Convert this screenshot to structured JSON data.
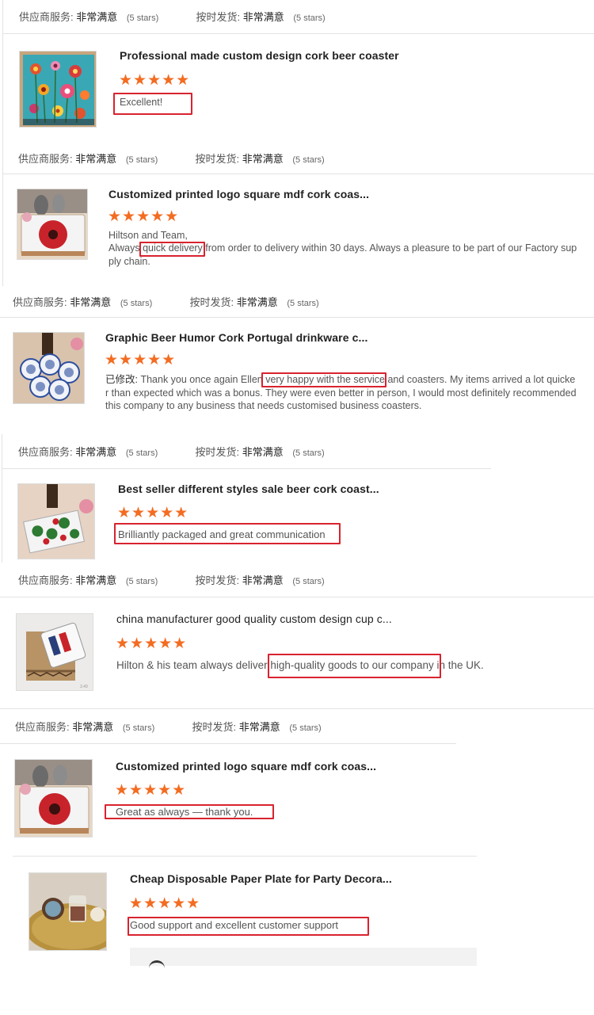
{
  "ratings_row": {
    "supplier_label": "供应商服务:",
    "supplier_value": "非常满意",
    "supplier_stars": "(5 stars)",
    "ontime_label": "按时发货:",
    "ontime_value": "非常满意",
    "ontime_stars": "(5 stars)"
  },
  "reviews": [
    {
      "title": "Professional made custom design cork beer coaster",
      "stars": "★★★★★",
      "text": "Excellent!"
    },
    {
      "title": "Customized printed logo square mdf cork coas...",
      "stars": "★★★★★",
      "line1": "Hiltson and Team,",
      "line2_a": "Always ",
      "line2_b": "quick delivery",
      "line2_c": " from order to delivery within 30 days. Always a pleasure to be part of our Factory sup",
      "line3": "ply chain."
    },
    {
      "title": "Graphic Beer Humor Cork Portugal drinkware c...",
      "stars": "★★★★★",
      "line1_a": "已修改: ",
      "line1_b": "Thank you once again Ellen ",
      "line1_c": "very happy with the service",
      "line1_d": " and coasters. My items arrived a lot quicke",
      "line2": "r than expected which was a bonus. They were even better in person, I would most definitely recommended",
      "line3": "this company to any business that needs customised business coasters."
    },
    {
      "title": "Best seller different styles sale beer cork coast...",
      "stars": "★★★★★",
      "text": "Brilliantly packaged and great communication"
    },
    {
      "title": "china manufacturer good quality custom design cup c...",
      "stars": "★★★★★",
      "text_a": "Hilton & his team always deliver ",
      "text_b": "high-quality goods to our company",
      "text_c": " in the UK."
    },
    {
      "title": "Customized printed logo square mdf cork coas...",
      "stars": "★★★★★",
      "text": "Great as always — thank you."
    },
    {
      "title": "Cheap Disposable Paper Plate for Party Decora...",
      "stars": "★★★★★",
      "text": "Good support and excellent customer support"
    }
  ],
  "colors": {
    "star": "#f36c21",
    "highlight_box": "#d9232f"
  },
  "icons": {
    "star": "star-icon",
    "product": "product-thumbnail"
  }
}
